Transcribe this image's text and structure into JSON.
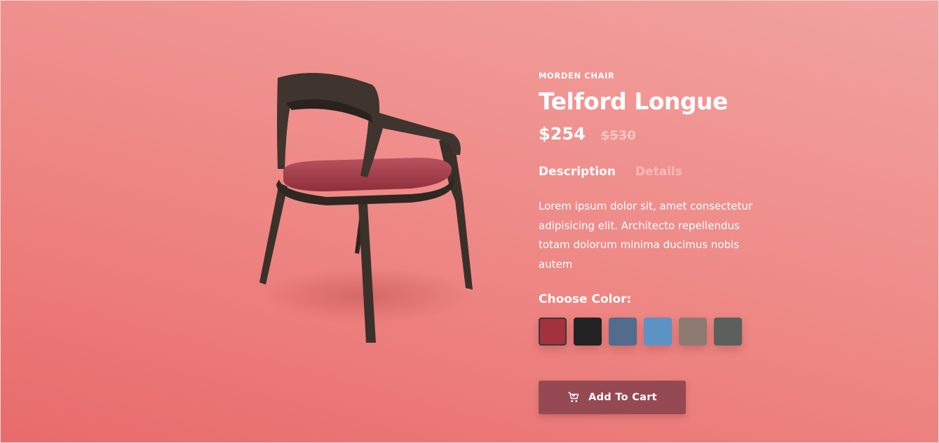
{
  "product": {
    "category": "MORDEN CHAIR",
    "name": "Telford Longue",
    "price": "$254",
    "old_price": "$530"
  },
  "tabs": [
    {
      "label": "Description",
      "active": true
    },
    {
      "label": "Details",
      "active": false
    }
  ],
  "description": "Lorem ipsum dolor sit, amet consectetur adipisicing elit. Architecto repellendus totam dolorum minima ducimus nobis autem",
  "color_section": {
    "label": "Choose Color:",
    "swatches": [
      {
        "color": "#a3313e",
        "selected": true
      },
      {
        "color": "#232324",
        "selected": false
      },
      {
        "color": "#516c8d",
        "selected": false
      },
      {
        "color": "#5d92c4",
        "selected": false
      },
      {
        "color": "#8d7b72",
        "selected": false
      },
      {
        "color": "#5b605c",
        "selected": false
      }
    ]
  },
  "cart_button": {
    "label": "Add To Cart",
    "icon": "cart-icon"
  },
  "colors": {
    "background_start": "#e86b6b",
    "background_end": "#f1a3a1",
    "button": "#954a53"
  }
}
